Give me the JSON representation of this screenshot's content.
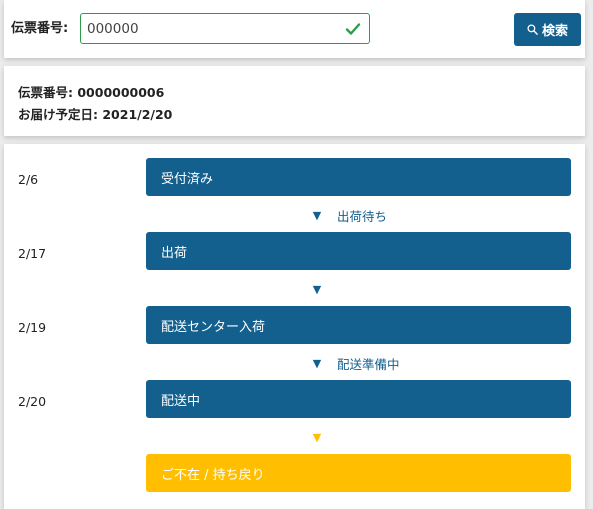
{
  "search": {
    "label": "伝票番号:",
    "value": "000000",
    "valid_icon": "check-icon",
    "button_label": "検索",
    "button_icon": "search-icon"
  },
  "info": {
    "slip_line": "伝票番号: 0000000006",
    "delivery_line": "お届け予定日: 2021/2/20"
  },
  "timeline": {
    "steps": [
      {
        "date": "2/6",
        "label": "受付済み"
      },
      {
        "date": "2/17",
        "label": "出荷"
      },
      {
        "date": "2/19",
        "label": "配送センター入荷"
      },
      {
        "date": "2/20",
        "label": "配送中"
      },
      {
        "date": "",
        "label": "ご不在 / 持ち戻り"
      }
    ],
    "connectors": [
      {
        "arrow": "▼",
        "text": "出荷待ち"
      },
      {
        "arrow": "▼",
        "text": ""
      },
      {
        "arrow": "▼",
        "text": "配送準備中"
      },
      {
        "arrow": "▼",
        "text": ""
      }
    ]
  },
  "colors": {
    "primary": "#135f8e",
    "warning": "#ffbf00",
    "valid": "#2e9c4a"
  }
}
